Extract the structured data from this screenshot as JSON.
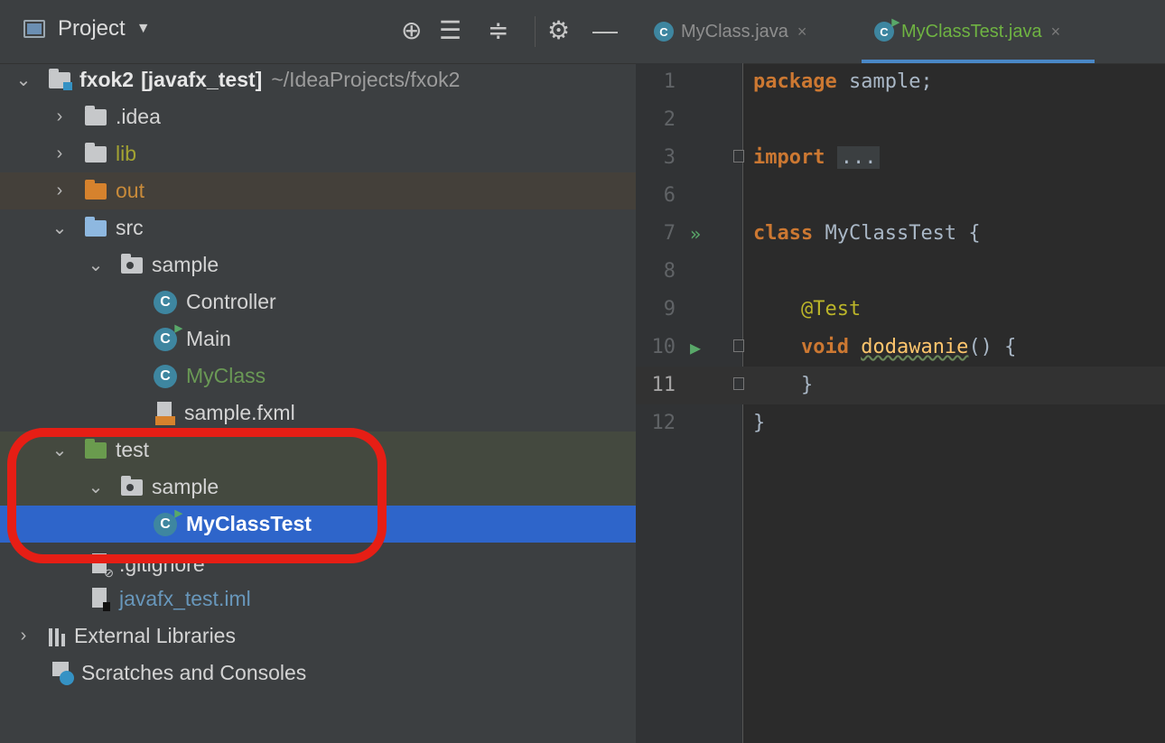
{
  "project_panel": {
    "title": "Project",
    "tree": {
      "root_name": "fxok2",
      "root_module": "[javafx_test]",
      "root_path": "~/IdeaProjects/fxok2",
      "idea": ".idea",
      "lib": "lib",
      "out": "out",
      "src": "src",
      "src_sample": "sample",
      "controller": "Controller",
      "main": "Main",
      "myclass": "MyClass",
      "sample_fxml": "sample.fxml",
      "test": "test",
      "test_sample": "sample",
      "myclasstest": "MyClassTest",
      "gitignore": ".gitignore",
      "iml": "javafx_test.iml",
      "external_libraries": "External Libraries",
      "scratches": "Scratches and Consoles"
    }
  },
  "editor": {
    "tabs": [
      {
        "label": "MyClass.java",
        "icon": "C"
      },
      {
        "label": "MyClassTest.java",
        "icon": "C"
      }
    ],
    "lines": [
      {
        "num": "1",
        "kw": "package",
        "rest": " sample;"
      },
      {
        "num": "2"
      },
      {
        "num": "3",
        "kw": "import",
        "folded": "..."
      },
      {
        "num": "6"
      },
      {
        "num": "7",
        "kw": "class",
        "rest": " MyClassTest {"
      },
      {
        "num": "8"
      },
      {
        "num": "9",
        "annotation": "@Test"
      },
      {
        "num": "10",
        "kw": "void",
        "fn": "dodawanie",
        "rest": "() {"
      },
      {
        "num": "11",
        "rest": "}"
      },
      {
        "num": "12",
        "rest": "}"
      }
    ]
  }
}
